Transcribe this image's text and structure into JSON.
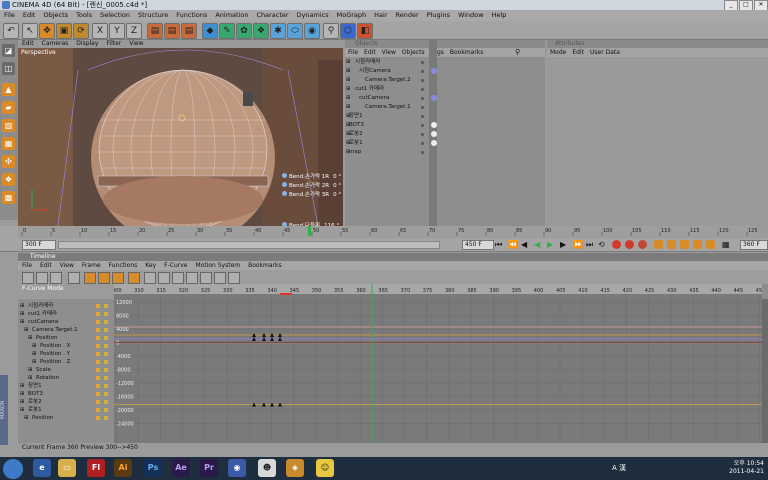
{
  "window": {
    "title": "CINEMA 4D (64 Bit) - [렌신_0005.c4d *]"
  },
  "menu": [
    "File",
    "Edit",
    "Objects",
    "Tools",
    "Selection",
    "Structure",
    "Functions",
    "Animation",
    "Character",
    "Dynamics",
    "MoGraph",
    "Hair",
    "Render",
    "Plugins",
    "Window",
    "Help"
  ],
  "viewport": {
    "menu": [
      "Edit",
      "Cameras",
      "Display",
      "Filter",
      "View"
    ],
    "label": "Perspective",
    "deformers": [
      {
        "label": "Bend.손가락 1R",
        "value": "0 °"
      },
      {
        "label": "Bend.손가락 2R",
        "value": "0 °"
      },
      {
        "label": "Bend.손가락 3R",
        "value": "0 °"
      },
      {
        "label": "Bend.다들피",
        "value": "116 °"
      },
      {
        "label": "Bend.손가락 1L",
        "value": "0 °"
      },
      {
        "label": "Bend.손가락 2L",
        "value": "0 °"
      },
      {
        "label": "Bend.손가락 3L",
        "value": "0 °"
      }
    ]
  },
  "objects": {
    "header": "Objects",
    "menu": [
      "File",
      "Edit",
      "View",
      "Objects",
      "Tags",
      "Bookmarks"
    ],
    "items": [
      "시점카메라",
      "시점Camera",
      "Camera.Target.2",
      "cut1 카메라",
      "cutCamera",
      "Camera.Target.1",
      "장면1",
      "BOT3",
      "로봇2",
      "로봇1",
      "map"
    ]
  },
  "attributes": {
    "header": "Attributes",
    "menu": [
      "Mode",
      "Edit",
      "User Data"
    ]
  },
  "ruler": {
    "ticks": [
      "0",
      "5",
      "10",
      "15",
      "20",
      "25",
      "30",
      "35",
      "40",
      "45",
      "50",
      "55",
      "60",
      "65",
      "70",
      "75",
      "80",
      "85",
      "90",
      "95",
      "100",
      "105",
      "110",
      "115",
      "120",
      "125"
    ],
    "frame_start": "300 F",
    "frame_end": "450 F",
    "frame_current": "360 F"
  },
  "timeline": {
    "header": "Timeline",
    "menu": [
      "File",
      "Edit",
      "View",
      "Frame",
      "Functions",
      "Key",
      "F-Curve",
      "Motion System",
      "Bookmarks"
    ],
    "mode_label": "F-Curve Mode",
    "tracks": [
      "시점카메라",
      "cut1 카메라",
      "cutCamera",
      "Camera.Target.1",
      "Position",
      "Position . X",
      "Position . Y",
      "Position . Z",
      "Scale",
      "Rotation",
      "장면1",
      "BOT3",
      "로봇2",
      "로봇1",
      "Position"
    ],
    "frame_ticks": [
      "300",
      "310",
      "315",
      "320",
      "325",
      "330",
      "335",
      "340",
      "345",
      "350",
      "355",
      "360",
      "365",
      "370",
      "375",
      "380",
      "385",
      "390",
      "395",
      "400",
      "405",
      "410",
      "415",
      "420",
      "425",
      "430",
      "435",
      "440",
      "445",
      "450"
    ],
    "value_ticks": [
      "12000",
      "8000",
      "4000",
      "0",
      "-4000",
      "-8000",
      "-12000",
      "-16000",
      "-20000",
      "-24000"
    ],
    "status": "Current Frame  360  Preview  300-->450"
  },
  "taskbar": {
    "apps": [
      "Fl",
      "Ai",
      "Ps",
      "Ae",
      "Pr"
    ],
    "ime": "A 漢",
    "time": "오후 10:54",
    "date": "2011-04-21"
  },
  "colors": {
    "accent": "#e07818",
    "green": "#2fb04a",
    "keyframe_orange": "#d08a2a"
  }
}
